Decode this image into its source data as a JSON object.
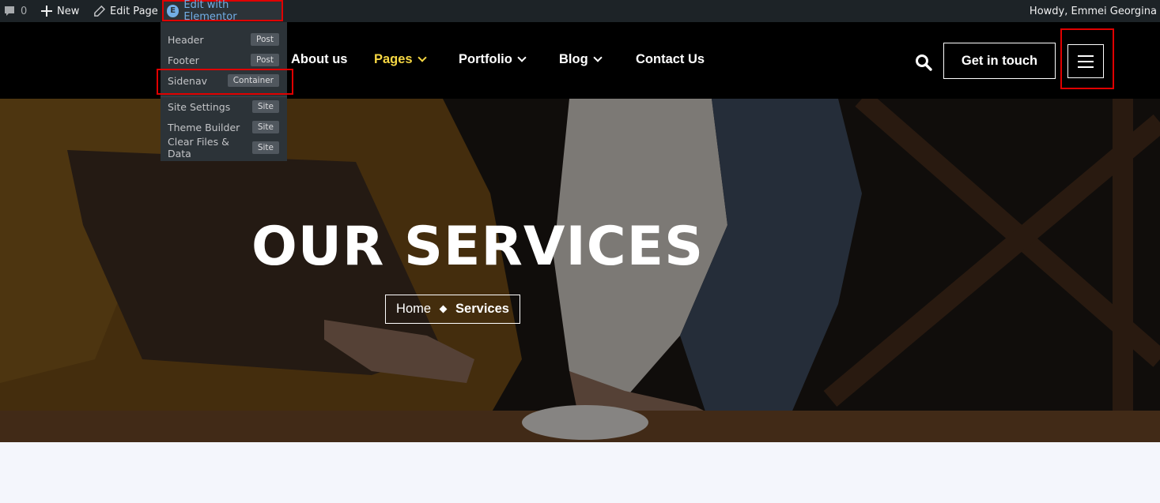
{
  "adminbar": {
    "comments_count": "0",
    "new_label": "New",
    "edit_page_label": "Edit Page",
    "elementor_label": "Edit with Elementor",
    "howdy": "Howdy, Emmei Georgina"
  },
  "dropdown": {
    "items": [
      {
        "label": "Header",
        "badge": "Post"
      },
      {
        "label": "Footer",
        "badge": "Post"
      },
      {
        "label": "Sidenav",
        "badge": "Container"
      },
      {
        "label": "Site Settings",
        "badge": "Site"
      },
      {
        "label": "Theme Builder",
        "badge": "Site"
      },
      {
        "label": "Clear Files & Data",
        "badge": "Site"
      }
    ]
  },
  "nav": {
    "items": [
      {
        "label": "About us"
      },
      {
        "label": "Pages"
      },
      {
        "label": "Portfolio"
      },
      {
        "label": "Blog"
      },
      {
        "label": "Contact Us"
      }
    ],
    "cta_label": "Get in touch"
  },
  "hero": {
    "title": "OUR SERVICES",
    "breadcrumb_home": "Home",
    "breadcrumb_current": "Services"
  },
  "colors": {
    "accent_yellow": "#f6d743",
    "highlight_red": "#e00000",
    "admin_bg": "#1d2327",
    "header_bg": "#000000"
  }
}
